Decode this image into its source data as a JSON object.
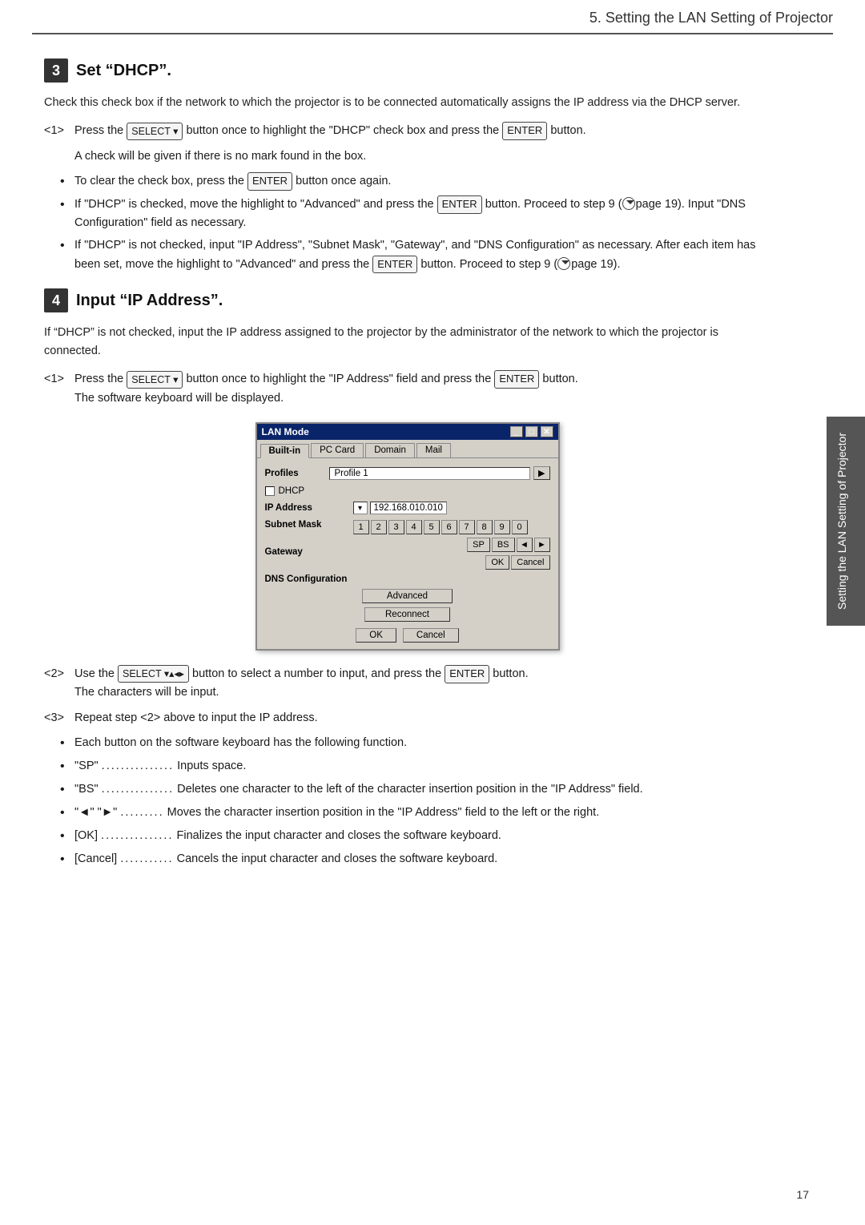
{
  "header": {
    "title": "5. Setting the LAN Setting of Projector"
  },
  "page_number": "17",
  "side_tab": {
    "text": "Setting the LAN Setting of Projector"
  },
  "section3": {
    "number": "3",
    "title": "Set “DHCP”.",
    "intro": "Check this check box if the network to which the projector is to be connected automatically assigns the IP address via the DHCP server.",
    "step1": {
      "num": "<1>",
      "text_before": "Press the",
      "key1": "SELECT ▾",
      "text_mid": "button once to highlight the “DHCP” check box and press the",
      "key2": "ENTER",
      "text_after": "button."
    },
    "indent_note": "A check will be given if there is no mark found in the box.",
    "bullets": [
      {
        "text": "To clear the check box, press the Ⓤ ENTER Ⓤ button once again."
      },
      {
        "text": "If “DHCP” is checked, move the highlight to “Advanced” and press the Ⓤ ENTER Ⓤ button. Proceed to step 9 (►page 19). Input “DNS Configuration” field as necessary."
      },
      {
        "text": "If “DHCP” is not checked, input “IP Address”, “Subnet Mask”, “Gateway”, and “DNS Configuration” as necessary.  After each item has been set, move the highlight to “Advanced” and press the Ⓤ ENTER Ⓤ button. Proceed to step 9 (►page 19)."
      }
    ]
  },
  "section4": {
    "number": "4",
    "title": "Input “IP Address”.",
    "intro": "If “DHCP” is not checked, input the IP address assigned to the projector by the administrator of the network to which the projector is connected.",
    "step1": {
      "num": "<1>",
      "text_before": "Press the",
      "key1": "SELECT ▾",
      "text_mid": "button once to highlight  the “IP Address” field and press the",
      "key2": "ENTER",
      "text_after": "button."
    },
    "step1_note": "The software keyboard will be displayed.",
    "step2": {
      "num": "<2>",
      "text_before": "Use the",
      "key1": "SELECT ▾▴◂▸",
      "text_mid": "button to select a number to input, and press the",
      "key2": "ENTER",
      "text_after": "button."
    },
    "step2_note": "The characters will be input.",
    "step3": {
      "num": "<3>",
      "text": "Repeat step <2> above to input the IP address."
    },
    "step3_bullets": [
      "Each button on the software keyboard has the following function.",
      "“SP” .................. Inputs space.",
      "“BS” .................. Deletes one character to the left of the character insertion position in the “IP Address” field.",
      "“◄” “►” .......... Moves the character insertion position in the “IP Address” field to the left or the right.",
      "[OK] .................. Finalizes the input character and closes the software keyboard.",
      "[Cancel] ........... Cancels the input character and closes the software keyboard."
    ]
  },
  "dialog": {
    "title": "LAN Mode",
    "tabs": [
      "Built-in",
      "PC Card",
      "Domain",
      "Mail"
    ],
    "active_tab": "Built-in",
    "profiles_label": "Profiles",
    "profiles_value": "Profile 1",
    "dhcp_label": "DHCP",
    "ip_label": "IP Address",
    "ip_value": "192.168.010.010",
    "subnet_label": "Subnet Mask",
    "gateway_label": "Gateway",
    "dns_label": "DNS Configuration",
    "keyboard_row1": [
      "1",
      "2",
      "3",
      "4",
      "5",
      "6",
      "7",
      "8",
      "9",
      "0"
    ],
    "keyboard_row2_special": [
      "SP",
      "BS",
      "◄",
      "►"
    ],
    "keyboard_row3_btns": [
      "OK",
      "Cancel"
    ],
    "advanced_btn": "Advanced",
    "reconnect_btn": "Reconnect",
    "ok_btn": "OK",
    "cancel_btn": "Cancel"
  }
}
